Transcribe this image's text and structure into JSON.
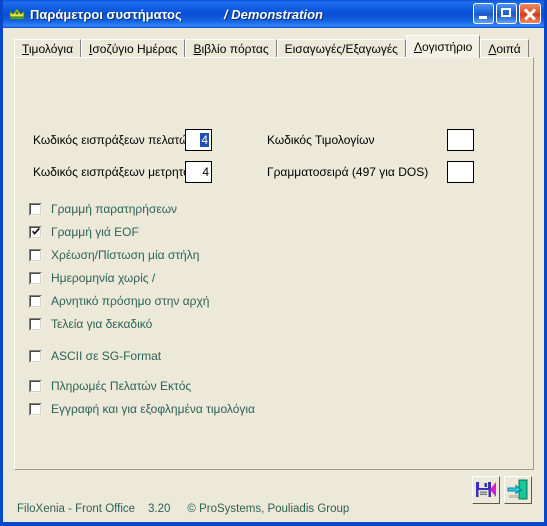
{
  "window": {
    "title": "Παράμετροι συστήματος",
    "center_title": "/ Demonstration",
    "app_icon": "crown-icon",
    "minimize_label": "Ελαχιστοποίηση",
    "maximize_label": "Μεγιστοποίηση",
    "close_label": "Κλείσιμο"
  },
  "tabs": [
    {
      "label": "Τιμολόγια",
      "accel": "Τ",
      "rest": "ιμολόγια",
      "active": false
    },
    {
      "label": "Ισοζύγιο Ημέρας",
      "accel": "Ι",
      "rest": "σοζύγιο Ημέρας",
      "active": false
    },
    {
      "label": "Βιβλίο πόρτας",
      "accel": "Β",
      "rest": "ιβλίο πόρτας",
      "active": false
    },
    {
      "label": "Εισαγωγές/Εξαγωγές",
      "accel": "",
      "rest": "Εισαγωγές/Εξαγωγές",
      "active": false
    },
    {
      "label": "Λογιστήριο",
      "accel": "Λ",
      "rest": "ογιστήριο",
      "active": true
    },
    {
      "label": "Λοιπά",
      "accel": "Λ",
      "rest": "οιπά",
      "active": false
    }
  ],
  "fields": [
    {
      "label": "Κωδικός εισπράξεων πελατών",
      "value": "4",
      "selected": true
    },
    {
      "label": "Κωδικός εισπράξεων μετρητοίς",
      "value": "4",
      "selected": false
    },
    {
      "label": "Κωδικός Τιμολογίων",
      "value": "",
      "selected": false
    },
    {
      "label": "Γραμματοσειρά (497 για DOS)",
      "value": "",
      "selected": false
    }
  ],
  "checkboxes": [
    {
      "label": "Γραμμή παρατηρήσεων",
      "checked": false
    },
    {
      "label": "Γραμμή γιά EOF",
      "checked": true
    },
    {
      "label": "Χρέωση/Πίστωση μία στήλη",
      "checked": false
    },
    {
      "label": "Ημερομηνία χωρίς /",
      "checked": false
    },
    {
      "label": "Αρνητικό πρόσημο στην αρχή",
      "checked": false
    },
    {
      "label": "Τελεία για δεκαδικό",
      "checked": false
    },
    {
      "label": "ASCII σε SG-Format",
      "checked": false
    },
    {
      "label": "Πληρωμές Πελατών Εκτός",
      "checked": false
    },
    {
      "label": "Εγγραφή και για εξοφλημένα τιμολόγια",
      "checked": false
    }
  ],
  "buttons": [
    {
      "name": "save-button",
      "icon": "floppy-disk-icon",
      "title": "Αποθήκευση"
    },
    {
      "name": "exit-button",
      "icon": "exit-door-icon",
      "title": "Έξοδος"
    }
  ],
  "statusbar": {
    "product": "FiloXenia - Front Office",
    "version": "3.20",
    "copyright": "© ProSystems, Pouliadis Group"
  },
  "colors": {
    "titlebar_blue": "#0a51d6",
    "window_border": "#0a46c8",
    "client_bg": "#ece9d8",
    "checkbox_label": "#2e6156",
    "status_text": "#2e6156",
    "selection_blue": "#2050b0",
    "close_button_red": "#cf3c18"
  }
}
